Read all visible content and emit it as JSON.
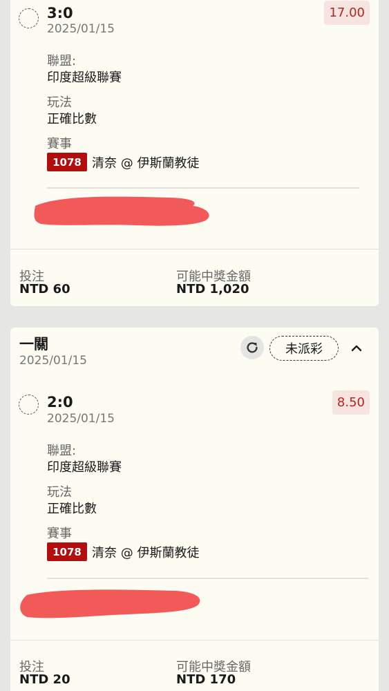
{
  "tickets": [
    {
      "selection": {
        "score": "3:0",
        "date": "2025/01/15",
        "odds": "17.00",
        "league_label": "聯盟:",
        "league": "印度超級聯賽",
        "bet_type_label": "玩法",
        "bet_type": "正確比數",
        "match_label": "賽事",
        "match_code": "1078",
        "match_name": "清奈 @ 伊斯蘭教徒"
      },
      "footer": {
        "stake_label": "投注",
        "stake": "NTD 60",
        "payout_label": "可能中獎金額",
        "payout": "NTD 1,020"
      }
    },
    {
      "title": "一關",
      "date": "2025/01/15",
      "status": "未派彩",
      "selection": {
        "score": "2:0",
        "date": "2025/01/15",
        "odds": "8.50",
        "league_label": "聯盟:",
        "league": "印度超級聯賽",
        "bet_type_label": "玩法",
        "bet_type": "正確比數",
        "match_label": "賽事",
        "match_code": "1078",
        "match_name": "清奈 @ 伊斯蘭教徒"
      },
      "footer": {
        "stake_label": "投注",
        "stake": "NTD 20",
        "payout_label": "可能中獎金額",
        "payout": "NTD 170"
      }
    }
  ],
  "icons": {
    "refresh": "refresh-icon",
    "collapse": "chevron-up-icon"
  },
  "colors": {
    "odds_text": "#b3261e",
    "odds_bg": "#f7e4e0",
    "match_code_bg": "#b30e0e",
    "redaction": "#f25a5a"
  }
}
